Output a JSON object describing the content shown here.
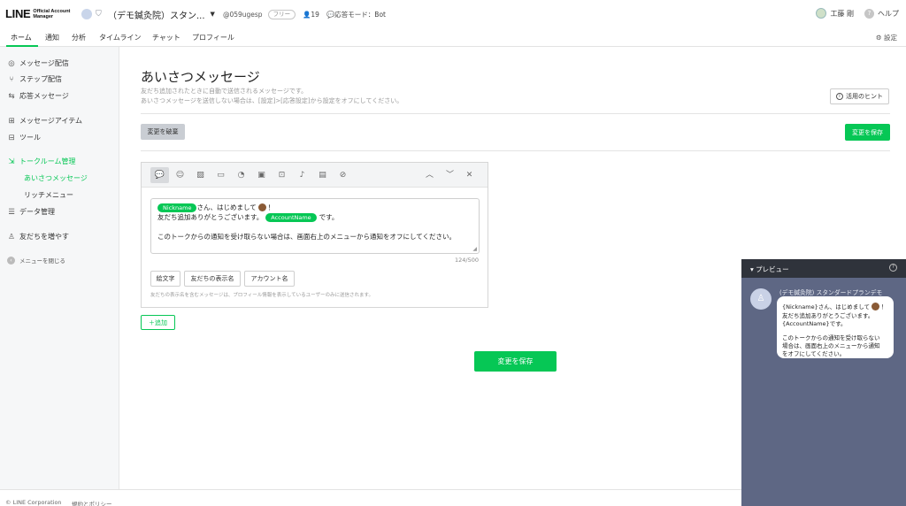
{
  "header": {
    "logo_main": "LINE",
    "logo_sub": "Official Account Manager",
    "account_name": "（デモ鍼灸院）スタン...",
    "account_id": "@059ugesp",
    "plan_badge": "フリー",
    "friend_count": "19",
    "response_mode": "応答モード：Bot",
    "user_name": "工藤 剛",
    "help_label": "ヘルプ"
  },
  "nav": {
    "tabs": [
      {
        "label": "ホーム"
      },
      {
        "label": "通知"
      },
      {
        "label": "分析"
      },
      {
        "label": "タイムライン"
      },
      {
        "label": "チャット"
      },
      {
        "label": "プロフィール"
      }
    ],
    "settings_label": "設定"
  },
  "sidebar": {
    "items": [
      {
        "label": "メッセージ配信",
        "icon": "broadcast-icon"
      },
      {
        "label": "ステップ配信",
        "icon": "step-icon"
      },
      {
        "label": "応答メッセージ",
        "icon": "reply-icon"
      },
      {
        "label": "メッセージアイテム",
        "icon": "item-icon"
      },
      {
        "label": "ツール",
        "icon": "tool-icon"
      },
      {
        "label": "トークルーム管理",
        "icon": "talkroom-icon"
      },
      {
        "label": "データ管理",
        "icon": "database-icon"
      },
      {
        "label": "友だちを増やす",
        "icon": "add-friend-icon"
      }
    ],
    "subitems": [
      {
        "label": "あいさつメッセージ"
      },
      {
        "label": "リッチメニュー"
      }
    ],
    "close_menu": "メニューを閉じる"
  },
  "main": {
    "title": "あいさつメッセージ",
    "desc_line1": "友だち追加されたときに自動で送信されるメッセージです。",
    "desc_line2": "あいさつメッセージを送信しない場合は、[設定]>[応答設定]から設定をオフにしてください。",
    "hint_button": "活用のヒント",
    "discard_button": "変更を破棄",
    "save_button": "変更を保存",
    "add_button": "追加"
  },
  "editor": {
    "nickname_tag": "Nickname",
    "line1_text": "さん、はじめまして",
    "line1_end": "！",
    "line2_text": "友だち追加ありがとうございます。",
    "account_tag": "AccountName",
    "line2_end": "です。",
    "line3_text": "このトークからの通知を受け取らない場合は、画面右上のメニューから通知をオフにしてください。",
    "counter": "124/500",
    "chips": [
      "絵文字",
      "友だちの表示名",
      "アカウント名"
    ],
    "note": "友だちの表示名を含むメッセージは、プロフィール情報を表示しているユーザーのみに送信されます。"
  },
  "preview": {
    "title": "プレビュー",
    "sender_name": "(デモ鍼灸院) スタンダードプランデモ",
    "bubble_line1": "{Nickname}さん、はじめまして",
    "bubble_line1_end": "！",
    "bubble_line2": "友だち追加ありがとうございます。",
    "bubble_line3": "{AccountName}です。",
    "bubble_line4": "このトークからの通知を受け取らない",
    "bubble_line5": "場合は、画面右上のメニューから通知",
    "bubble_line6": "をオフにしてください。"
  },
  "footer": {
    "copyright": "© LINE Corporation",
    "policy": "規約とポリシー"
  },
  "colors": {
    "accent": "#06c755",
    "preview_bg": "#5e6784",
    "preview_header": "#2f333b"
  }
}
